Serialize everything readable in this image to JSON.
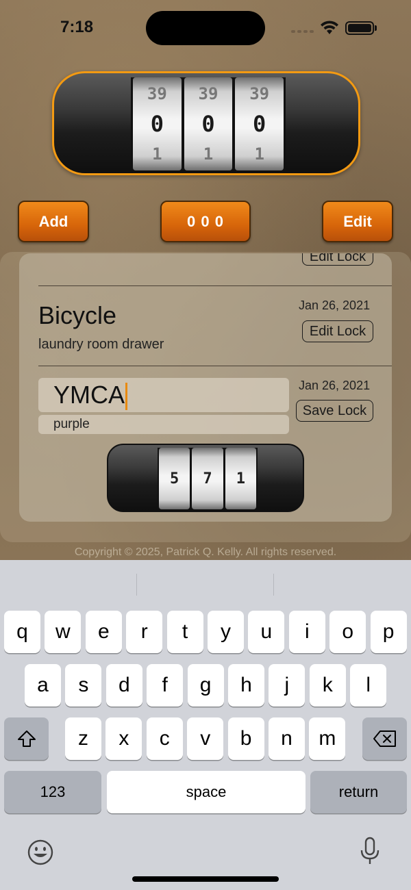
{
  "status_bar": {
    "time": "7:18"
  },
  "big_lock": {
    "wheels": [
      {
        "prev": "39",
        "current": "0",
        "next": "1"
      },
      {
        "prev": "39",
        "current": "0",
        "next": "1"
      },
      {
        "prev": "39",
        "current": "0",
        "next": "1"
      }
    ],
    "accent_color": "#f39a12"
  },
  "actions": {
    "add_label": "Add",
    "combo_label": "0 0 0",
    "edit_label": "Edit"
  },
  "list": {
    "partial_item": {
      "edit_label": "Edit Lock"
    },
    "items": [
      {
        "title": "Bicycle",
        "subtitle": "laundry room drawer",
        "date": "Jan 26, 2021",
        "action_label": "Edit Lock"
      }
    ],
    "editing_item": {
      "title_value": "YMCA",
      "subtitle_value": "purple",
      "date": "Jan 26, 2021",
      "action_label": "Save Lock",
      "combination": [
        "5",
        "7",
        "1"
      ]
    }
  },
  "footer": {
    "copyright": "Copyright © 2025, Patrick Q. Kelly. All rights reserved."
  },
  "keyboard": {
    "row1": [
      "q",
      "w",
      "e",
      "r",
      "t",
      "y",
      "u",
      "i",
      "o",
      "p"
    ],
    "row2": [
      "a",
      "s",
      "d",
      "f",
      "g",
      "h",
      "j",
      "k",
      "l"
    ],
    "row3": [
      "z",
      "x",
      "c",
      "v",
      "b",
      "n",
      "m"
    ],
    "numbers_label": "123",
    "space_label": "space",
    "return_label": "return",
    "icons": [
      "shift-icon",
      "delete-icon",
      "emoji-icon",
      "microphone-icon"
    ]
  }
}
